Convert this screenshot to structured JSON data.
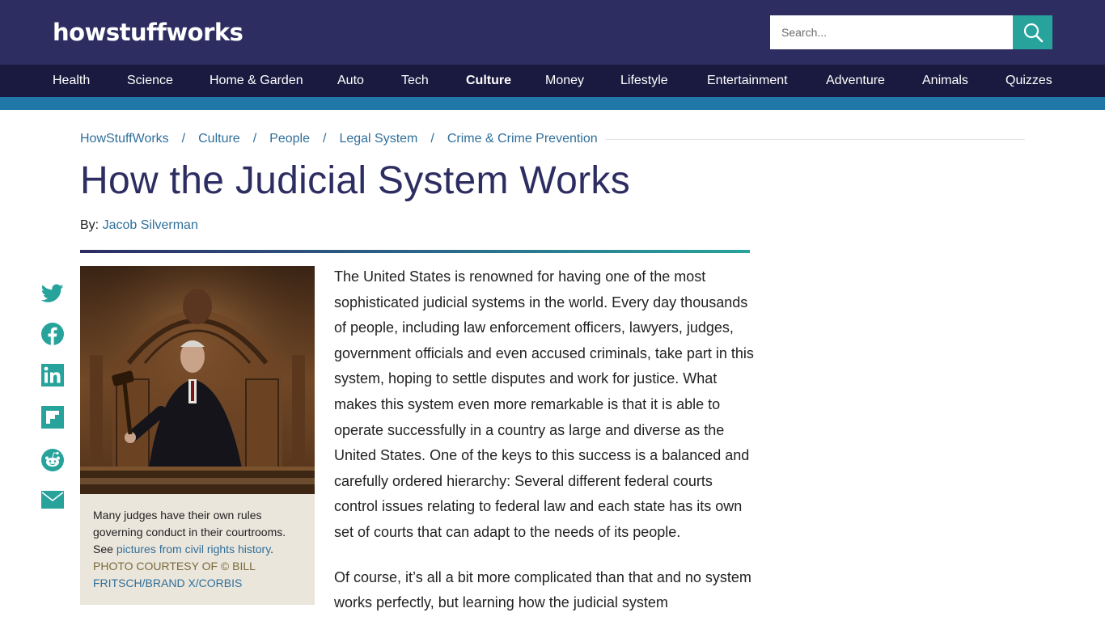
{
  "header": {
    "logo_text": "howstuffworks",
    "search": {
      "placeholder": "Search...",
      "value": ""
    }
  },
  "nav": {
    "items": [
      "Health",
      "Science",
      "Home & Garden",
      "Auto",
      "Tech",
      "Culture",
      "Money",
      "Lifestyle",
      "Entertainment",
      "Adventure",
      "Animals",
      "Quizzes"
    ],
    "active": "Culture"
  },
  "breadcrumb": [
    "HowStuffWorks",
    "Culture",
    "People",
    "Legal System",
    "Crime & Crime Prevention"
  ],
  "article": {
    "title": "How the Judicial System Works",
    "byline_prefix": "By:",
    "author": "Jacob Silverman",
    "paragraphs": [
      "The United States is renowned for having one of the most sophisticated judicial systems in the world. Every day thousands of people, including law enforcement officers, lawyers, judges, government officials and even accused criminals, take part in this system, hoping to settle disputes and work for justice. What makes this system even more remarkable is that it is able to operate successfully in a country as large and diverse as the United States. One of the keys to this success is a balanced and carefully ordered hierarchy: Several different federal courts control issues relating to federal law and each state has its own set of courts that can adapt to the needs of its people.",
      "Of course, it’s all a bit more complicated than that and no system works perfectly, but learning how the judicial system"
    ]
  },
  "figure": {
    "caption_text": "Many judges have their own rules governing conduct in their courtrooms. See ",
    "caption_link": "pictures from civil rights history",
    "caption_end": ".",
    "credit_prefix": "PHOTO COURTESY OF © BILL",
    "credit_link": "FRITSCH/BRAND X/CORBIS"
  },
  "social": [
    "twitter-icon",
    "facebook-icon",
    "linkedin-icon",
    "flipboard-icon",
    "reddit-icon",
    "email-icon"
  ],
  "colors": {
    "header_bg": "#2d2d62",
    "nav_bg": "#1a1a40",
    "accent_teal": "#27a39c",
    "strip_blue": "#1f78a8",
    "link_blue": "#2f6f9a",
    "caption_bg": "#ebe6dc"
  }
}
